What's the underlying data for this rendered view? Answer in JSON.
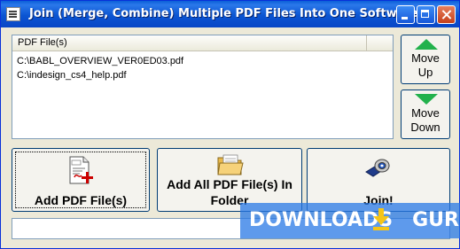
{
  "window": {
    "title": "Join (Merge, Combine) Multiple PDF Files Into One Software"
  },
  "file_list": {
    "column_header": "PDF File(s)",
    "items": [
      "C:\\BABL_OVERVIEW_VER0ED03.pdf",
      "C:\\indesign_cs4_help.pdf"
    ]
  },
  "buttons": {
    "move_up": [
      "Move",
      "Up"
    ],
    "move_down": [
      "Move",
      "Down"
    ],
    "add_pdf": "Add PDF File(s)",
    "add_folder": [
      "Add All PDF File(s) In",
      "Folder"
    ],
    "join": "Join!"
  },
  "status": "",
  "watermark": {
    "text_left": "DOWNLOADS",
    "text_right": "GURU",
    "logo_color": "#f5c518"
  },
  "colors": {
    "titlebar": "#0b55d2",
    "arrow_green": "#22b14c",
    "pdf_red": "#cc0000"
  },
  "icons": {
    "add_pdf": "pdf-add-icon",
    "add_folder": "folder-icon",
    "join": "tape-icon"
  }
}
